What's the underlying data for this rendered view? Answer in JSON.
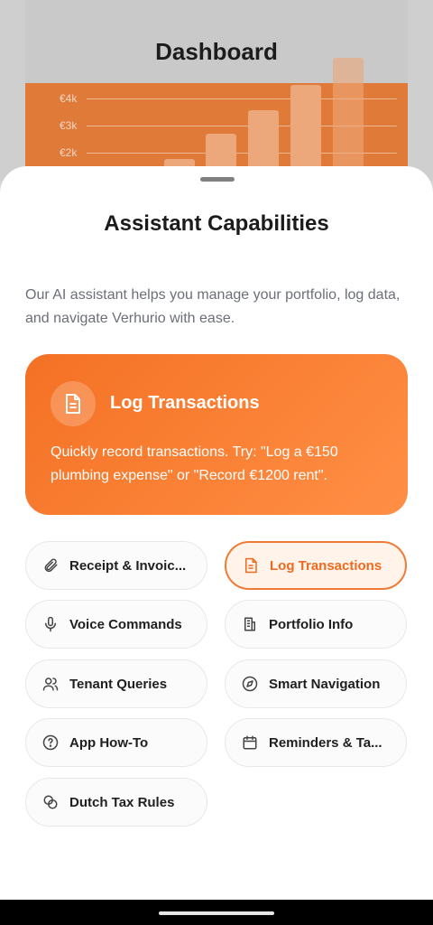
{
  "background": {
    "title": "Dashboard",
    "y_ticks": [
      "€4k",
      "€3k",
      "€2k"
    ]
  },
  "sheet": {
    "title": "Assistant Capabilities",
    "description": "Our AI assistant helps you manage your portfolio, log data, and navigate Verhurio with ease.",
    "hero": {
      "icon": "document-icon",
      "title": "Log Transactions",
      "description": "Quickly record transactions. Try: \"Log a €150 plumbing expense\" or \"Record €1200 rent\"."
    },
    "chips": [
      {
        "label": "Receipt & Invoic...",
        "icon": "paperclip-icon",
        "active": false
      },
      {
        "label": "Log Transactions",
        "icon": "document-icon",
        "active": true
      },
      {
        "label": "Voice Commands",
        "icon": "microphone-icon",
        "active": false
      },
      {
        "label": "Portfolio Info",
        "icon": "building-icon",
        "active": false
      },
      {
        "label": "Tenant Queries",
        "icon": "users-icon",
        "active": false
      },
      {
        "label": "Smart Navigation",
        "icon": "compass-icon",
        "active": false
      },
      {
        "label": "App How-To",
        "icon": "help-circle-icon",
        "active": false
      },
      {
        "label": "Reminders & Ta...",
        "icon": "calendar-icon",
        "active": false
      },
      {
        "label": "Dutch Tax Rules",
        "icon": "coins-icon",
        "active": false
      }
    ]
  },
  "colors": {
    "accent": "#F47124",
    "active_chip_text": "#EF6A1F"
  }
}
